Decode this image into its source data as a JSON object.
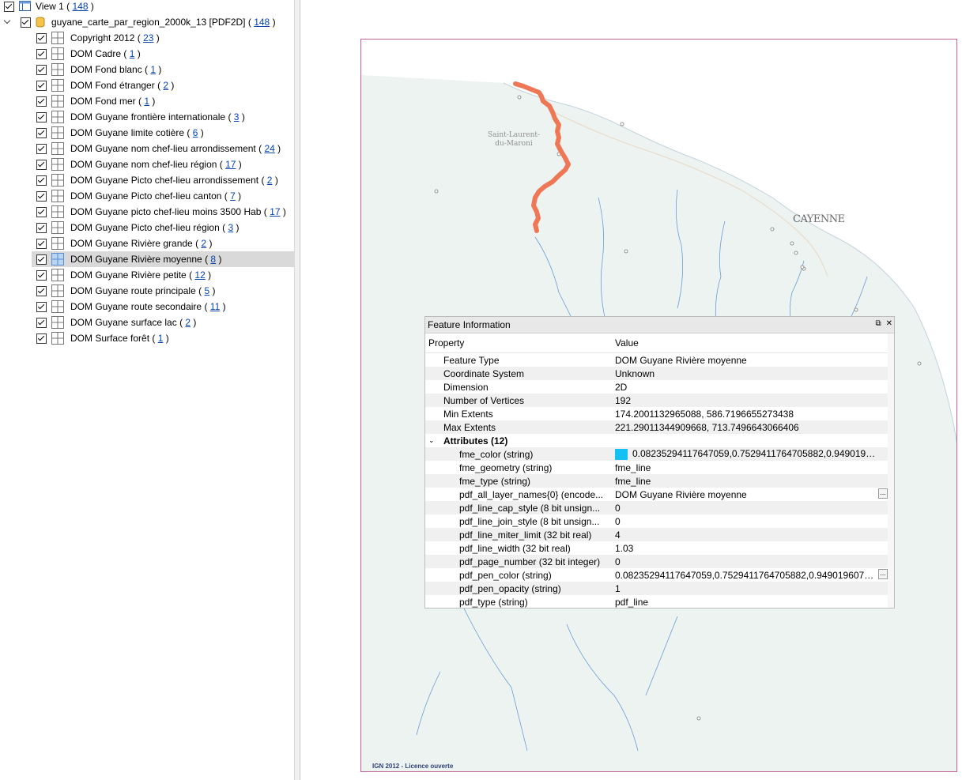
{
  "tree": {
    "view": {
      "label": "View 1",
      "count": "148"
    },
    "dataset": {
      "label": "guyane_carte_par_region_2000k_13 [PDF2D]",
      "count": "148"
    },
    "layers": [
      {
        "label": "Copyright 2012",
        "count": "23"
      },
      {
        "label": "DOM Cadre",
        "count": "1"
      },
      {
        "label": "DOM Fond blanc",
        "count": "1"
      },
      {
        "label": "DOM Fond étranger",
        "count": "2"
      },
      {
        "label": "DOM Fond mer",
        "count": "1"
      },
      {
        "label": "DOM Guyane frontière internationale",
        "count": "3"
      },
      {
        "label": "DOM Guyane limite cotière",
        "count": "6"
      },
      {
        "label": "DOM Guyane nom chef-lieu arrondissement",
        "count": "24"
      },
      {
        "label": "DOM Guyane nom chef-lieu région",
        "count": "17"
      },
      {
        "label": "DOM Guyane Picto chef-lieu arrondissement",
        "count": "2"
      },
      {
        "label": "DOM Guyane Picto chef-lieu canton",
        "count": "7"
      },
      {
        "label": "DOM Guyane picto chef-lieu moins 3500 Hab",
        "count": "17"
      },
      {
        "label": "DOM Guyane Picto chef-lieu région",
        "count": "3"
      },
      {
        "label": "DOM Guyane Rivière grande",
        "count": "2"
      },
      {
        "label": "DOM Guyane Rivière moyenne",
        "count": "8"
      },
      {
        "label": "DOM Guyane Rivière petite",
        "count": "12"
      },
      {
        "label": "DOM Guyane route principale",
        "count": "5"
      },
      {
        "label": "DOM Guyane route secondaire",
        "count": "11"
      },
      {
        "label": "DOM Guyane surface lac",
        "count": "2"
      },
      {
        "label": "DOM Surface forêt",
        "count": "1"
      }
    ]
  },
  "map": {
    "labels": {
      "cayenne": "CAYENNE",
      "saint_laurent_1": "Saint-Laurent-",
      "saint_laurent_2": "du-Maroni",
      "copyright": "IGN 2012 - Licence ouverte"
    }
  },
  "panel": {
    "title": "Feature Information",
    "col_property": "Property",
    "col_value": "Value",
    "rows": [
      {
        "k": "Feature Type",
        "v": "DOM Guyane Rivière moyenne"
      },
      {
        "k": "Coordinate System",
        "v": "Unknown"
      },
      {
        "k": "Dimension",
        "v": "2D"
      },
      {
        "k": "Number of Vertices",
        "v": "192"
      },
      {
        "k": "Min Extents",
        "v": "174.2001132965088, 586.7196655273438"
      },
      {
        "k": "Max Extents",
        "v": "221.29011344909668, 713.7496643066406"
      }
    ],
    "attr_group": "Attributes (12)",
    "attrs": [
      {
        "k": "fme_color (string)",
        "v": "0.08235294117647059,0.7529411764705882,0.9490196078431..."
      },
      {
        "k": "fme_geometry (string)",
        "v": "fme_line"
      },
      {
        "k": "fme_type (string)",
        "v": "fme_line"
      },
      {
        "k": "pdf_all_layer_names{0} (encode...",
        "v": "DOM Guyane Rivière moyenne"
      },
      {
        "k": "pdf_line_cap_style (8 bit unsign...",
        "v": "0"
      },
      {
        "k": "pdf_line_join_style (8 bit unsign...",
        "v": "0"
      },
      {
        "k": "pdf_line_miter_limit (32 bit real)",
        "v": "4"
      },
      {
        "k": "pdf_line_width (32 bit real)",
        "v": "1.03"
      },
      {
        "k": "pdf_page_number (32 bit integer)",
        "v": "0"
      },
      {
        "k": "pdf_pen_color (string)",
        "v": "0.08235294117647059,0.7529411764705882,0.9490196078431372"
      },
      {
        "k": "pdf_pen_opacity (string)",
        "v": "1"
      },
      {
        "k": "pdf_type (string)",
        "v": "pdf_line"
      }
    ],
    "dots_label": "...",
    "color_swatch": "#15c0f2"
  },
  "colors": {
    "river_highlight": "#ee7756",
    "frame_border": "#c2629a"
  }
}
